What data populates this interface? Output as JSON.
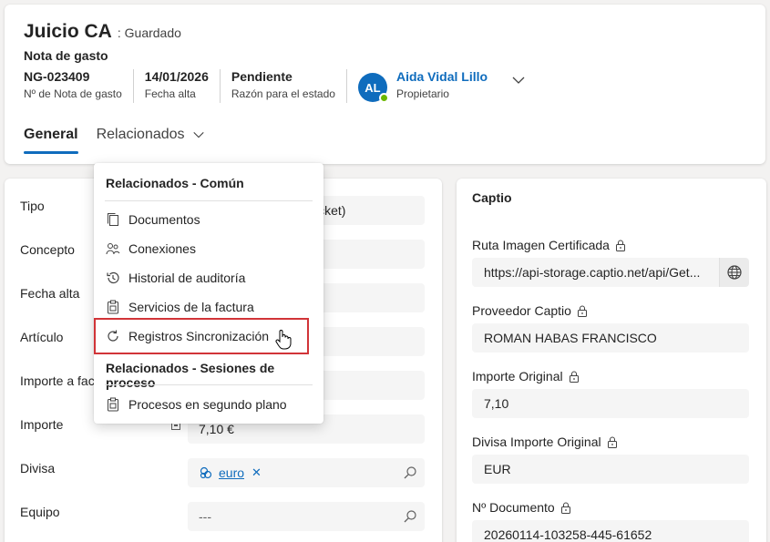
{
  "header": {
    "title": "Juicio CA",
    "saved_status": ": Guardado",
    "entity_type": "Nota de gasto",
    "facts": [
      {
        "value": "NG-023409",
        "label": "Nº de Nota de gasto"
      },
      {
        "value": "14/01/2026",
        "label": "Fecha alta"
      },
      {
        "value": "Pendiente",
        "label": "Razón para el estado"
      }
    ],
    "owner": {
      "initials": "AL",
      "name": "Aida Vidal Lillo",
      "label": "Propietario",
      "presence_color": "#6bb700"
    },
    "tabs": [
      {
        "label": "General",
        "active": true
      },
      {
        "label": "Relacionados",
        "active": false
      }
    ]
  },
  "general_form": {
    "rows": [
      {
        "label": "Tipo",
        "value": "icket)"
      },
      {
        "label": "Concepto",
        "value": ""
      },
      {
        "label": "Fecha alta",
        "value": ""
      },
      {
        "label": "Artículo",
        "value": ""
      },
      {
        "label": "Importe a fac",
        "value": ""
      },
      {
        "label": "Importe",
        "value": "7,10 €"
      },
      {
        "label": "Divisa",
        "value": "euro"
      },
      {
        "label": "Equipo",
        "value": "---"
      }
    ]
  },
  "captio": {
    "title": "Captio",
    "fields": [
      {
        "label": "Ruta Imagen Certificada",
        "value": "https://api-storage.captio.net/api/Get..."
      },
      {
        "label": "Proveedor Captio",
        "value": "ROMAN HABAS FRANCISCO"
      },
      {
        "label": "Importe Original",
        "value": "7,10"
      },
      {
        "label": "Divisa Importe Original",
        "value": "EUR"
      },
      {
        "label": "Nº Documento",
        "value": "20260114-103258-445-61652"
      }
    ]
  },
  "menu": {
    "group1": "Relacionados - Común",
    "items": [
      {
        "label": "Documentos",
        "icon": "documents-icon"
      },
      {
        "label": "Conexiones",
        "icon": "connections-icon"
      },
      {
        "label": "Historial de auditoría",
        "icon": "history-icon"
      },
      {
        "label": "Servicios de la factura",
        "icon": "clipboard-icon"
      },
      {
        "label": "Registros Sincronización",
        "icon": "sync-icon"
      }
    ],
    "group2": "Relacionados - Sesiones de proceso",
    "items2": [
      {
        "label": "Procesos en segundo plano",
        "icon": "clipboard-icon"
      }
    ]
  },
  "colors": {
    "accent": "#0f6cbd",
    "highlight_outline": "#d13438"
  }
}
